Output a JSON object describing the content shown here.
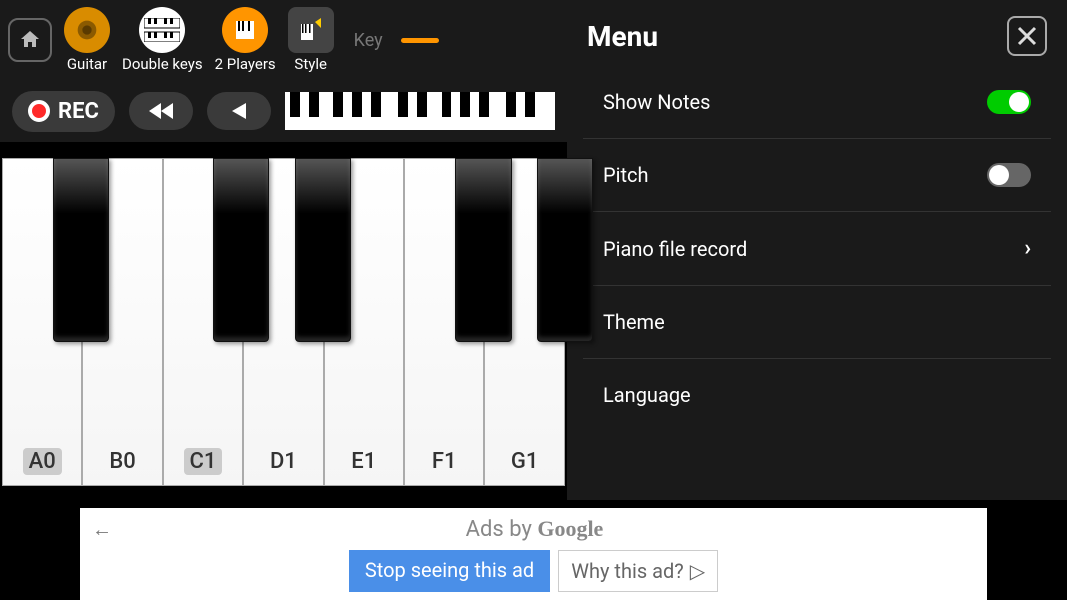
{
  "toolbar": {
    "instruments": [
      {
        "name": "guitar",
        "label": "Guitar",
        "icon_bg": "#d98c00"
      },
      {
        "name": "double-keys",
        "label": "Double keys",
        "icon_bg": "#fff"
      },
      {
        "name": "two-players",
        "label": "2 Players",
        "icon_bg": "#ff9500"
      },
      {
        "name": "style",
        "label": "Style",
        "icon_bg": "#333"
      }
    ],
    "key_label": "Key"
  },
  "controls": {
    "rec_label": "REC"
  },
  "keyboard": {
    "white_keys": [
      {
        "label": "A0",
        "pressed": true
      },
      {
        "label": "B0",
        "pressed": false
      },
      {
        "label": "C1",
        "pressed": true
      },
      {
        "label": "D1",
        "pressed": false
      },
      {
        "label": "E1",
        "pressed": false
      },
      {
        "label": "F1",
        "pressed": false
      },
      {
        "label": "G1",
        "pressed": false
      }
    ]
  },
  "menu": {
    "title": "Menu",
    "items": [
      {
        "label": "Show Notes",
        "type": "toggle",
        "on": true
      },
      {
        "label": "Pitch",
        "type": "toggle",
        "on": false
      },
      {
        "label": "Piano file record",
        "type": "chevron"
      },
      {
        "label": "Theme",
        "type": "none"
      },
      {
        "label": "Language",
        "type": "none"
      }
    ]
  },
  "ad": {
    "title_prefix": "Ads by ",
    "title_brand": "Google",
    "stop_label": "Stop seeing this ad",
    "why_label": "Why this ad?"
  }
}
